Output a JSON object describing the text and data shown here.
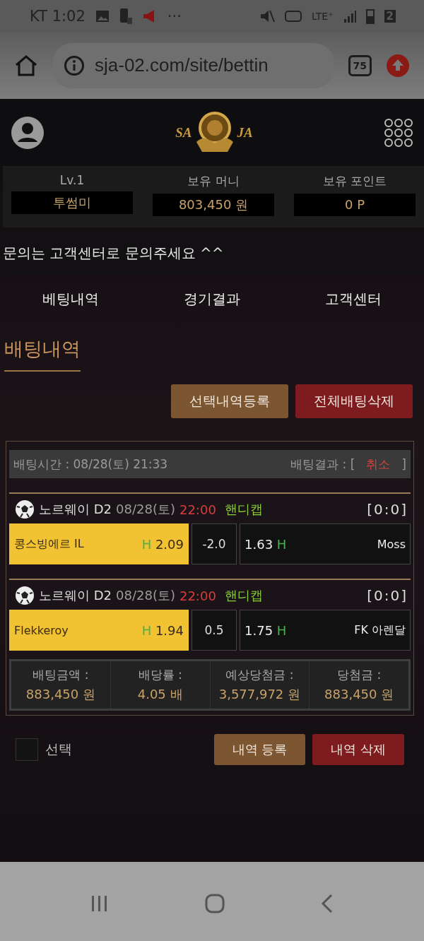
{
  "status_bar": {
    "carrier_time": "KT 1:02",
    "more": "···",
    "network": "LTE⁺",
    "sim": "2"
  },
  "browser": {
    "url": "sja-02.com/site/bettin",
    "tab_count": "75"
  },
  "header": {
    "logo_left": "SA",
    "logo_right": "JA"
  },
  "stats": [
    {
      "label": "Lv.1",
      "value": "투썸미"
    },
    {
      "label": "보유 머니",
      "value": "803,450 원"
    },
    {
      "label": "보유 포인트",
      "value": "0 P"
    }
  ],
  "notice": "문의는 고객센터로 문의주세요 ^^",
  "tabs": [
    {
      "label": "베팅내역",
      "selected": false
    },
    {
      "label": "경기결과",
      "selected": false
    },
    {
      "label": "고객센터",
      "selected": false
    }
  ],
  "section_title": "배팅내역",
  "top_buttons": [
    {
      "label": "선택내역등록",
      "kind": "register"
    },
    {
      "label": "전체배팅삭제",
      "kind": "delete"
    }
  ],
  "bet": {
    "time_label": "배팅시간 : 08/28(토) 21:33",
    "result_label": "배팅결과 : [",
    "result": "취소",
    "result_close": "]",
    "games": [
      {
        "league": "노르웨이 D2",
        "date": "08/28(토)",
        "time": "22:00",
        "type": "핸디캡",
        "score": "[0:0]",
        "home": "콩스빙에르 IL",
        "home_mark": "H",
        "home_odds": "2.09",
        "handicap": "-2.0",
        "away_odds": "1.63",
        "away_mark": "H",
        "away": "Moss",
        "home_selected": true,
        "away_selected": false
      },
      {
        "league": "노르웨이 D2",
        "date": "08/28(토)",
        "time": "22:00",
        "type": "핸디캡",
        "score": "[0:0]",
        "home": "Flekkeroy",
        "home_mark": "H",
        "home_odds": "1.94",
        "handicap": "0.5",
        "away_odds": "1.75",
        "away_mark": "H",
        "away": "FK 아렌달",
        "home_selected": true,
        "away_selected": false
      }
    ],
    "summary": [
      {
        "label": "배팅금액 :",
        "value": "883,450 원"
      },
      {
        "label": "배당률 :",
        "value": "4.05 배"
      },
      {
        "label": "예상당첨금 :",
        "value": "3,577,972 원"
      },
      {
        "label": "당첨금 :",
        "value": "883,450 원"
      }
    ]
  },
  "select": {
    "label": "선택",
    "checked": false
  },
  "bottom_buttons": [
    {
      "label": "내역 등록",
      "kind": "register"
    },
    {
      "label": "내역 삭제",
      "kind": "delete"
    }
  ]
}
